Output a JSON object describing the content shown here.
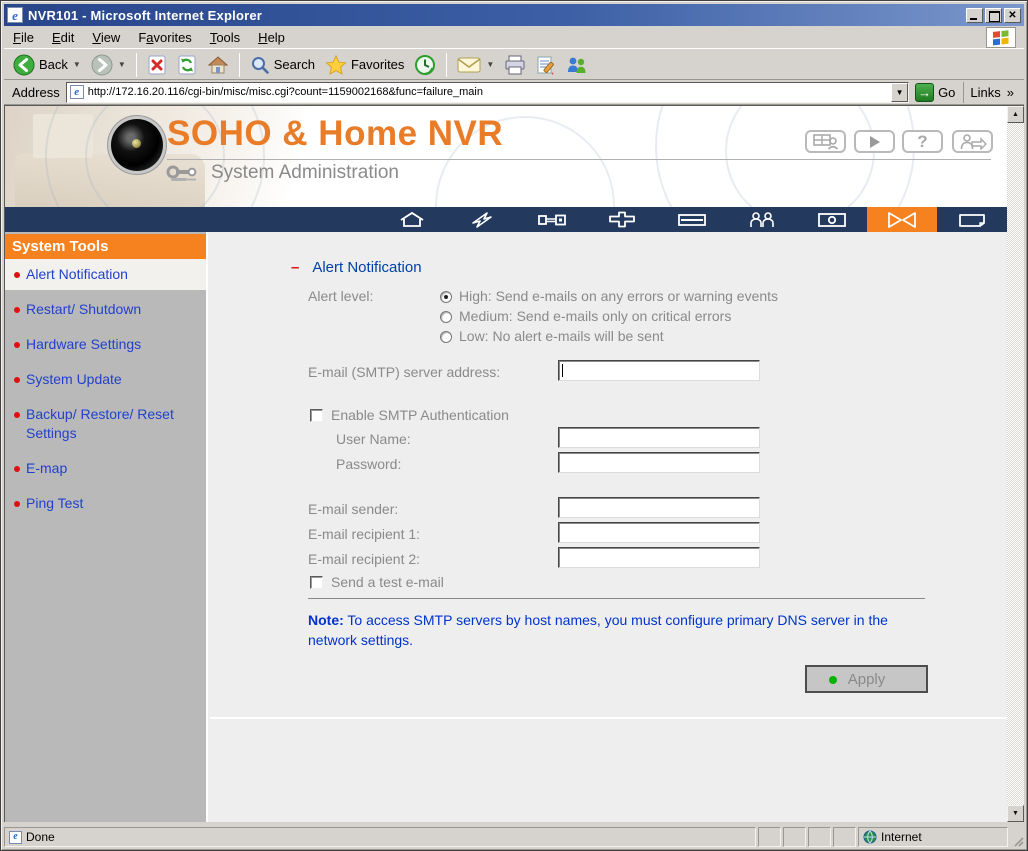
{
  "window": {
    "title": "NVR101 - Microsoft Internet Explorer",
    "caption_buttons": [
      "minimize",
      "maximize",
      "close"
    ]
  },
  "menu": {
    "items": [
      {
        "pre": "",
        "u": "F",
        "post": "ile"
      },
      {
        "pre": "",
        "u": "E",
        "post": "dit"
      },
      {
        "pre": "",
        "u": "V",
        "post": "iew"
      },
      {
        "pre": "F",
        "u": "a",
        "post": "vorites"
      },
      {
        "pre": "",
        "u": "T",
        "post": "ools"
      },
      {
        "pre": "",
        "u": "H",
        "post": "elp"
      }
    ]
  },
  "toolbar": {
    "back_label": "Back",
    "search_label": "Search",
    "favorites_label": "Favorites"
  },
  "address": {
    "label": "Address",
    "url": "http://172.16.20.116/cgi-bin/misc/misc.cgi?count=1159002168&func=failure_main",
    "go_label": "Go",
    "go_arrow": "→",
    "links_label": "Links",
    "links_chevron": "»"
  },
  "banner": {
    "title": "SOHO & Home NVR",
    "subtitle": "System Administration",
    "buttons": [
      "monitor",
      "playback",
      "help",
      "logout"
    ]
  },
  "nav": {
    "items": [
      "home",
      "quick-setup",
      "system-settings",
      "network-settings",
      "device-settings",
      "user-management",
      "camera-settings",
      "system-tools",
      "logs"
    ],
    "active_index": 7
  },
  "sidebar": {
    "title": "System Tools",
    "items": [
      {
        "label": "Alert Notification",
        "selected": true
      },
      {
        "label": "Restart/ Shutdown",
        "selected": false
      },
      {
        "label": "Hardware Settings",
        "selected": false
      },
      {
        "label": "System Update",
        "selected": false
      },
      {
        "label": "Backup/ Restore/ Reset Settings",
        "selected": false
      },
      {
        "label": "E-map",
        "selected": false
      },
      {
        "label": "Ping Test",
        "selected": false
      }
    ]
  },
  "main": {
    "heading_dash": "–",
    "heading": "Alert Notification",
    "alert_level_label": "Alert level:",
    "alert_options": [
      {
        "label": "High: Send e-mails on any errors or warning events",
        "selected": true
      },
      {
        "label": "Medium: Send e-mails only on critical errors",
        "selected": false
      },
      {
        "label": "Low: No alert e-mails will be sent",
        "selected": false
      }
    ],
    "smtp_label": "E-mail (SMTP) server address:",
    "smtp_value": "",
    "enable_auth_label": "Enable SMTP Authentication",
    "enable_auth_checked": false,
    "username_label": "User Name:",
    "username_value": "",
    "password_label": "Password:",
    "password_value": "",
    "sender_label": "E-mail sender:",
    "sender_value": "",
    "recipient1_label": "E-mail recipient 1:",
    "recipient1_value": "",
    "recipient2_label": "E-mail recipient 2:",
    "recipient2_value": "",
    "send_test_label": "Send a test e-mail",
    "send_test_checked": false,
    "note_bold": "Note:",
    "note_text": " To access SMTP servers by host names, you must configure primary DNS server in the network settings.",
    "apply_label": "Apply"
  },
  "statusbar": {
    "left": "Done",
    "right": "Internet"
  },
  "colors": {
    "accent_orange": "#f5821f",
    "nav_navy": "#24395e",
    "brand_orange": "#e87c28",
    "sidebar_link_blue": "#2141cc",
    "heading_blue": "#0040a8",
    "note_blue": "#0033cc",
    "label_gray": "#8a8a8a",
    "bullet_red": "#e01010",
    "apply_dot_green": "#00b400",
    "sidebar_gray": "#b9b9b9",
    "content_gray": "#eeeeee"
  }
}
